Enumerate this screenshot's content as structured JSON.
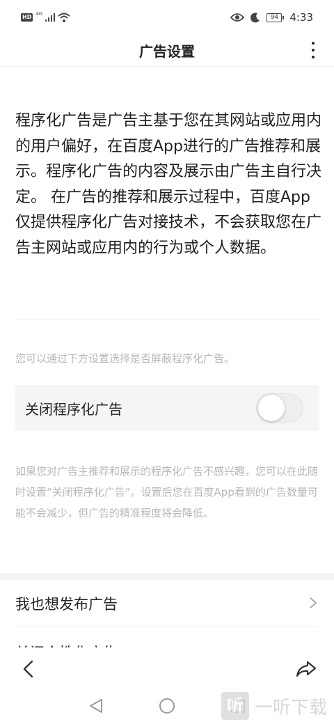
{
  "status_bar": {
    "hd_badge": "HD",
    "network_label": "4G",
    "battery_level": "94",
    "time": "4:33"
  },
  "header": {
    "title": "广告设置"
  },
  "intro_text": "程序化广告是广告主基于您在其网站或应用内的用户偏好，在百度App进行的广告推荐和展示。程序化广告的内容及展示由广告主自行决定。 在广告的推荐和展示过程中，百度App仅提供程序化广告对接技术，不会获取您在广告主网站或应用内的行为或个人数据。",
  "hint_text": "您可以通过下方设置选择是否屏蔽程序化广告。",
  "toggle_row": {
    "label": "关闭程序化广告",
    "state": "off"
  },
  "description": "如果您对广告主推荐和展示的程序化广告不感兴趣，您可以在此随时设置“关闭程序化广告”。设置后您在百度App看到的广告数量可能不会减少，但广告的精准程度将会降低。",
  "menu": {
    "publish_label": "我也想发布广告",
    "personalized_label": "关闭个性化广告"
  },
  "watermark": {
    "logo_char": "听",
    "text": "一听下载"
  },
  "icons": {
    "more": "more-vertical-icon",
    "back": "chevron-left-icon",
    "share": "share-icon",
    "chevron_right": "chevron-right-icon"
  }
}
